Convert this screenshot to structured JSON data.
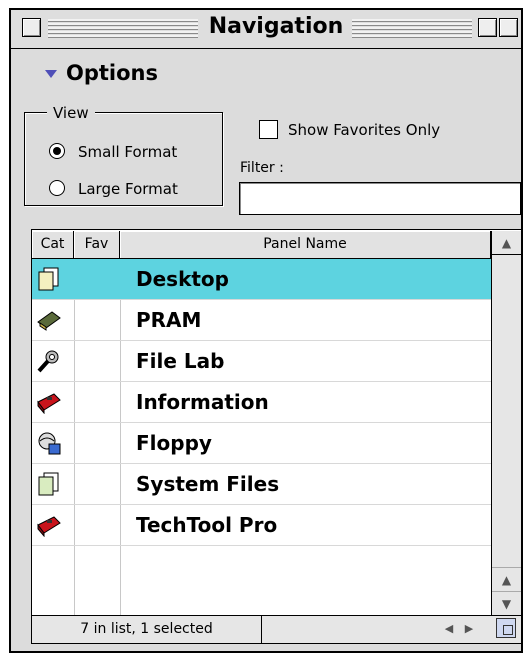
{
  "window": {
    "title": "Navigation"
  },
  "options": {
    "label": "Options"
  },
  "view": {
    "legend": "View",
    "small_format_label": "Small Format",
    "large_format_label": "Large Format",
    "selected": "Small Format"
  },
  "favorites": {
    "label": "Show Favorites Only",
    "checked": false
  },
  "filter": {
    "label": "Filter :",
    "value": ""
  },
  "list": {
    "columns": {
      "cat": "Cat",
      "fav": "Fav",
      "name": "Panel Name"
    },
    "rows": [
      {
        "name": "Desktop",
        "icon": "document-stack-icon",
        "selected": true
      },
      {
        "name": "PRAM",
        "icon": "memory-chip-icon",
        "selected": false
      },
      {
        "name": "File Lab",
        "icon": "wrench-icon",
        "selected": false
      },
      {
        "name": "Information",
        "icon": "red-toolbox-icon",
        "selected": false
      },
      {
        "name": "Floppy",
        "icon": "globe-disk-icon",
        "selected": false
      },
      {
        "name": "System Files",
        "icon": "document-stack-icon",
        "selected": false
      },
      {
        "name": "TechTool Pro",
        "icon": "red-toolbox-icon",
        "selected": false
      }
    ],
    "status": "7 in list, 1 selected"
  },
  "colors": {
    "selection": "#5dd3e0",
    "disclosure": "#4f4fb8",
    "toolbox_red": "#c8141c"
  }
}
